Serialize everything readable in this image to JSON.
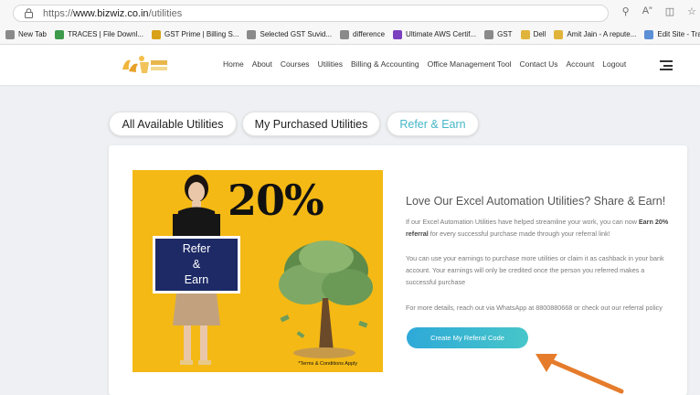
{
  "browser": {
    "url_prefix": "https://",
    "url_domain": "www.bizwiz.co.in",
    "url_path": "/utilities",
    "bookmarks": [
      {
        "label": "New Tab",
        "color": "#8a8a8a"
      },
      {
        "label": "TRACES | File Downl...",
        "color": "#3c9a4a"
      },
      {
        "label": "GST Prime | Billing S...",
        "color": "#d8a117"
      },
      {
        "label": "Selected GST Suvid...",
        "color": "#8a8a8a"
      },
      {
        "label": "difference",
        "color": "#8a8a8a"
      },
      {
        "label": "Ultimate AWS Certif...",
        "color": "#7b3fbf"
      },
      {
        "label": "GST",
        "color": "#8a8a8a"
      },
      {
        "label": "Dell",
        "color": "#e0b43a"
      },
      {
        "label": "Amit Jain - A repute...",
        "color": "#e0b43a"
      },
      {
        "label": "Edit Site - Training b...",
        "color": "#5b8fd6"
      }
    ]
  },
  "nav": {
    "items": [
      "Home",
      "About",
      "Courses",
      "Utilities",
      "Billing & Accounting",
      "Office Management Tool",
      "Contact Us",
      "Account",
      "Logout"
    ]
  },
  "tabs": {
    "all": "All Available Utilities",
    "purchased": "My Purchased Utilities",
    "refer": "Refer & Earn"
  },
  "promo": {
    "percent": "20%",
    "sign_line1": "Refer",
    "sign_line2": "&",
    "sign_line3": "Earn",
    "terms": "*Terms & Conditions Apply"
  },
  "content": {
    "heading": "Love Our Excel Automation Utilities? Share & Earn!",
    "p1_start": "If our Excel Automation Utilities have helped streamline your work, you can now ",
    "p1_bold": "Earn 20% referral",
    "p1_end": " for every successful purchase made through your referral link!",
    "p2": "You can use your earnings to purchase more utilities or claim it as cashback in your bank account. Your earnings will only be credited once the person you referred makes a successful purchase",
    "p3": "For more details, reach out via WhatsApp at 8800880668 or check out our referral policy",
    "cta": "Create My Referal Code"
  },
  "colors": {
    "accent": "#45b6c7",
    "promo_bg": "#f4b915",
    "sign_bg": "#1d2a66",
    "arrow": "#e57c2c"
  }
}
